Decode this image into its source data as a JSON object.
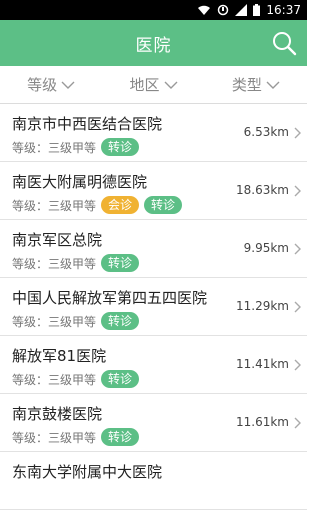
{
  "status": {
    "time": "16:37"
  },
  "header": {
    "title": "医院"
  },
  "filters": [
    {
      "label": "等级"
    },
    {
      "label": "地区"
    },
    {
      "label": "类型"
    }
  ],
  "hospitals": [
    {
      "name": "南京市中西医结合医院",
      "grade": "等级：三级甲等",
      "tags": [
        "转诊"
      ],
      "distance": "6.53km"
    },
    {
      "name": "南医大附属明德医院",
      "grade": "等级：三级甲等",
      "tags": [
        "会诊",
        "转诊"
      ],
      "distance": "18.63km"
    },
    {
      "name": "南京军区总院",
      "grade": "等级：三级甲等",
      "tags": [
        "转诊"
      ],
      "distance": "9.95km"
    },
    {
      "name": "中国人民解放军第四五四医院",
      "grade": "等级：三级甲等",
      "tags": [
        "转诊"
      ],
      "distance": "11.29km"
    },
    {
      "name": "解放军81医院",
      "grade": "等级：三级甲等",
      "tags": [
        "转诊"
      ],
      "distance": "11.41km"
    },
    {
      "name": "南京鼓楼医院",
      "grade": "等级：三级甲等",
      "tags": [
        "转诊"
      ],
      "distance": "11.61km"
    },
    {
      "name": "东南大学附属中大医院",
      "grade": "",
      "tags": [],
      "distance": ""
    }
  ],
  "colors": {
    "primary": "#5cbf86",
    "consult": "#f0b232"
  }
}
